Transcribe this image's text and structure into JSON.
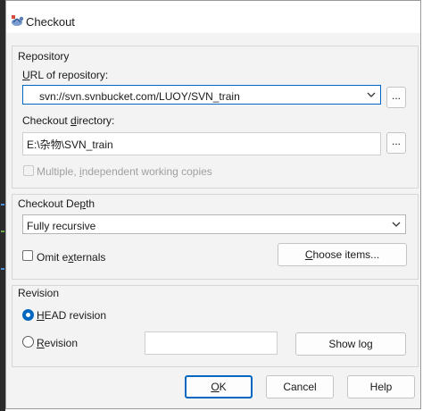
{
  "window": {
    "title": "Checkout",
    "icon": "tortoise-svn-icon"
  },
  "repository": {
    "group_label": "Repository",
    "url_label": "URL of repository:",
    "url_value": "svn://svn.svnbucket.com/LUOY/SVN_train",
    "browse_label": "...",
    "dir_label": "Checkout directory:",
    "dir_value": "E:\\杂物\\SVN_train",
    "multiple_label": "Multiple, independent working copies"
  },
  "depth": {
    "group_label": "Checkout Depth",
    "value": "Fully recursive",
    "omit_label": "Omit externals",
    "choose_label": "Choose items..."
  },
  "revision": {
    "group_label": "Revision",
    "head_label": "HEAD revision",
    "revision_label": "Revision",
    "revision_value": "",
    "showlog_label": "Show log"
  },
  "buttons": {
    "ok": "OK",
    "cancel": "Cancel",
    "help": "Help"
  },
  "colors": {
    "accent": "#0067c0",
    "dialog_bg": "#f3f3f3"
  }
}
